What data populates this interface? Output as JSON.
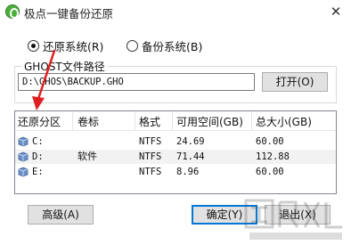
{
  "window": {
    "title": "极点一键备份还原",
    "close_glyph": "✕"
  },
  "mode": {
    "restore_label": "还原系统(R)",
    "backup_label": "备份系统(B)",
    "selected": "restore"
  },
  "ghost_path": {
    "group_label": "GHOST文件路径",
    "value": "D:\\GHOS\\BACKUP.GHO",
    "open_button": "打开(O)"
  },
  "partitions": {
    "headers": [
      "还原分区",
      "卷标",
      "格式",
      "可用空间(GB)",
      "总大小(GB)"
    ],
    "rows": [
      {
        "drive": "C:",
        "label": "",
        "format": "NTFS",
        "free": "24.69",
        "total": "60.00"
      },
      {
        "drive": "D:",
        "label": "软件",
        "format": "NTFS",
        "free": "71.44",
        "total": "112.88"
      },
      {
        "drive": "E:",
        "label": "",
        "format": "NTFS",
        "free": "8.96",
        "total": "60.00"
      }
    ]
  },
  "buttons": {
    "advanced": "高级(A)",
    "ok": "确定(Y)",
    "exit": "退出(X)"
  },
  "colors": {
    "annotation_arrow": "#e02020",
    "app_icon": "#4caf3a",
    "drive_icon": "#6b8fc7"
  }
}
